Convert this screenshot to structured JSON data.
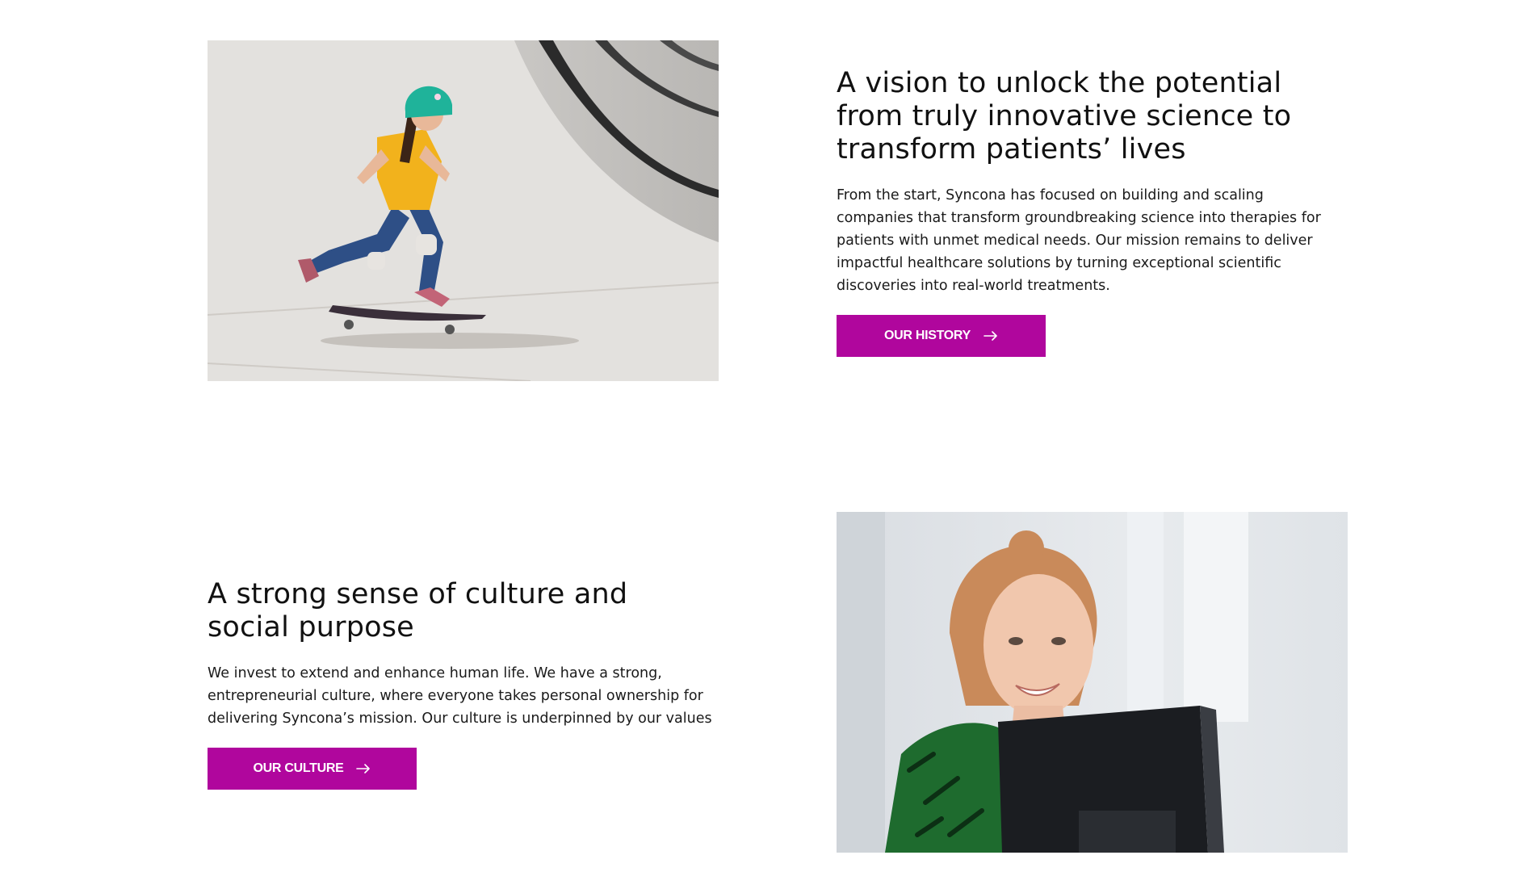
{
  "colors": {
    "accent": "#b0069d",
    "background": "#ffffff",
    "text": "#111111"
  },
  "vision": {
    "image": "skateboarding-girl-photo",
    "heading": "A vision to unlock the potential from truly innovative science to transform patients’ lives",
    "body": "From the start, Syncona has focused on building and scaling companies that transform groundbreaking science into therapies for patients with unmet medical needs. Our mission remains to deliver impactful healthcare solutions by turning exceptional scientific discoveries into real-world treatments.",
    "button_label": "OUR HISTORY",
    "button_icon": "arrow-right-icon"
  },
  "culture": {
    "image": "smiling-woman-at-computer-photo",
    "heading": "A strong sense of culture and social purpose",
    "body": "We invest to extend and enhance human life. We have a strong, entrepreneurial culture, where everyone takes personal ownership for delivering Syncona’s mission. Our culture is underpinned by our values",
    "button_label": "OUR CULTURE",
    "button_icon": "arrow-right-icon"
  }
}
